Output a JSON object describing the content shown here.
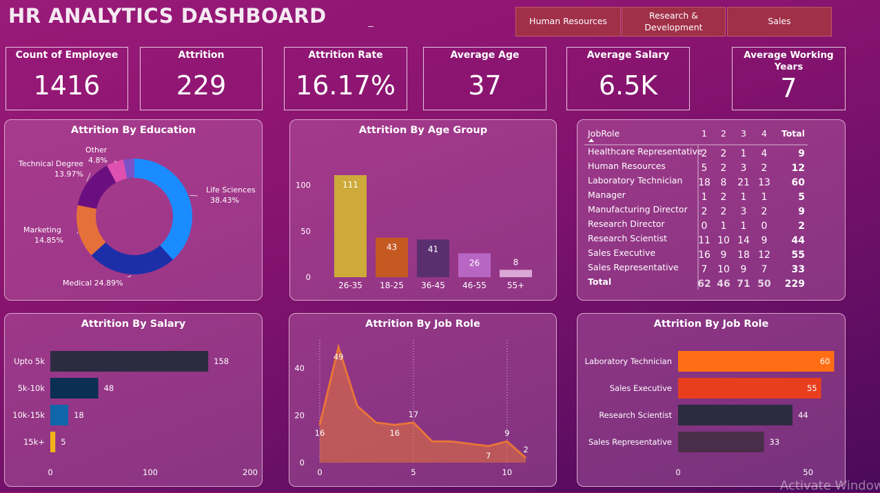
{
  "header": {
    "title": "HR ANALYTICS DASHBOARD"
  },
  "departments": [
    "Human Resources",
    "Research & Development",
    "Sales"
  ],
  "kpis": [
    {
      "label": "Count of Employee",
      "value": "1416"
    },
    {
      "label": "Attrition",
      "value": "229"
    },
    {
      "label": "Attrition Rate",
      "value": "16.17%"
    },
    {
      "label": "Average Age",
      "value": "37"
    },
    {
      "label": "Average Salary",
      "value": "6.5K"
    },
    {
      "label": "Average Working Years",
      "value": "7"
    }
  ],
  "panels": {
    "education_title": "Attrition By Education",
    "age_title": "Attrition By Age Group",
    "salary_title": "Attrition By Salary",
    "jobrole_line_title": "Attrition By Job Role",
    "jobrole_bar_title": "Attrition By Job Role"
  },
  "jobrole_table": {
    "headers": [
      "JobRole",
      "1",
      "2",
      "3",
      "4",
      "Total"
    ],
    "rows": [
      {
        "role": "Healthcare Representative",
        "values": [
          "2",
          "2",
          "1",
          "4",
          "9"
        ]
      },
      {
        "role": "Human Resources",
        "values": [
          "5",
          "2",
          "3",
          "2",
          "12"
        ]
      },
      {
        "role": "Laboratory Technician",
        "values": [
          "18",
          "8",
          "21",
          "13",
          "60"
        ]
      },
      {
        "role": "Manager",
        "values": [
          "1",
          "2",
          "1",
          "1",
          "5"
        ]
      },
      {
        "role": "Manufacturing Director",
        "values": [
          "2",
          "2",
          "3",
          "2",
          "9"
        ]
      },
      {
        "role": "Research Director",
        "values": [
          "0",
          "1",
          "1",
          "0",
          "2"
        ]
      },
      {
        "role": "Research Scientist",
        "values": [
          "11",
          "10",
          "14",
          "9",
          "44"
        ]
      },
      {
        "role": "Sales Executive",
        "values": [
          "16",
          "9",
          "18",
          "12",
          "55"
        ]
      },
      {
        "role": "Sales Representative",
        "values": [
          "7",
          "10",
          "9",
          "7",
          "33"
        ]
      }
    ],
    "total": {
      "role": "Total",
      "values": [
        "62",
        "46",
        "71",
        "50",
        "229"
      ]
    }
  },
  "chart_data": [
    {
      "type": "pie",
      "title": "Attrition By Education",
      "donut": true,
      "slices": [
        {
          "label": "Life Sciences",
          "value": 38.43,
          "display": "38.43%",
          "color": "#1a8cff"
        },
        {
          "label": "Medical",
          "value": 24.89,
          "display": "24.89%",
          "color": "#1c2fa8"
        },
        {
          "label": "Marketing",
          "value": 14.85,
          "display": "14.85%",
          "color": "#e6703a"
        },
        {
          "label": "Technical Degree",
          "value": 13.97,
          "display": "13.97%",
          "color": "#6b0f80"
        },
        {
          "label": "Other",
          "value": 4.8,
          "display": "4.8%",
          "color": "#e050b0"
        },
        {
          "label": "",
          "value": 3.06,
          "display": "",
          "color": "#7b52c8"
        }
      ]
    },
    {
      "type": "bar",
      "title": "Attrition By Age Group",
      "categories": [
        "26-35",
        "18-25",
        "36-45",
        "46-55",
        "55+"
      ],
      "values": [
        111,
        43,
        41,
        26,
        8
      ],
      "colors": [
        "#cdaa3a",
        "#c45a22",
        "#5a2f70",
        "#b866c4",
        "#d9a6d6"
      ],
      "ylim": [
        0,
        120
      ],
      "yticks": [
        0,
        50,
        100
      ]
    },
    {
      "type": "bar",
      "orientation": "horizontal",
      "title": "Attrition By Salary",
      "categories": [
        "Upto 5k",
        "5k-10k",
        "10k-15k",
        "15k+"
      ],
      "values": [
        158,
        48,
        18,
        5
      ],
      "colors": [
        "#2c2c40",
        "#0a2f52",
        "#1166aa",
        "#f2b418"
      ],
      "xlim": [
        0,
        200
      ],
      "xticks": [
        0,
        100,
        200
      ]
    },
    {
      "type": "area",
      "title": "Attrition By Job Role",
      "x": [
        0,
        1,
        2,
        3,
        4,
        5,
        6,
        7,
        8,
        9,
        10,
        11
      ],
      "y": [
        16,
        49,
        24,
        17,
        16,
        17,
        9,
        9,
        8,
        7,
        9,
        2
      ],
      "labeled_points": [
        {
          "x": 0,
          "y": 16,
          "label": "16"
        },
        {
          "x": 1,
          "y": 49,
          "label": "49"
        },
        {
          "x": 4,
          "y": 16,
          "label": "16"
        },
        {
          "x": 5,
          "y": 17,
          "label": "17"
        },
        {
          "x": 9,
          "y": 7,
          "label": "7"
        },
        {
          "x": 10,
          "y": 9,
          "label": "9"
        },
        {
          "x": 11,
          "y": 2,
          "label": "2"
        }
      ],
      "xlim": [
        0,
        11
      ],
      "ylim": [
        0,
        52
      ],
      "xticks": [
        0,
        5,
        10
      ],
      "yticks": [
        0,
        20,
        40
      ],
      "color": "#e8743a"
    },
    {
      "type": "bar",
      "orientation": "horizontal",
      "title": "Attrition By Job Role",
      "categories": [
        "Laboratory Technician",
        "Sales Executive",
        "Research Scientist",
        "Sales Representative"
      ],
      "values": [
        60,
        55,
        44,
        33
      ],
      "colors": [
        "#ff6e14",
        "#e83e1e",
        "#2c2c40",
        "#4a2d48"
      ],
      "xlim": [
        0,
        62
      ],
      "xticks": [
        0,
        50
      ]
    }
  ],
  "watermark": "Activate Window"
}
